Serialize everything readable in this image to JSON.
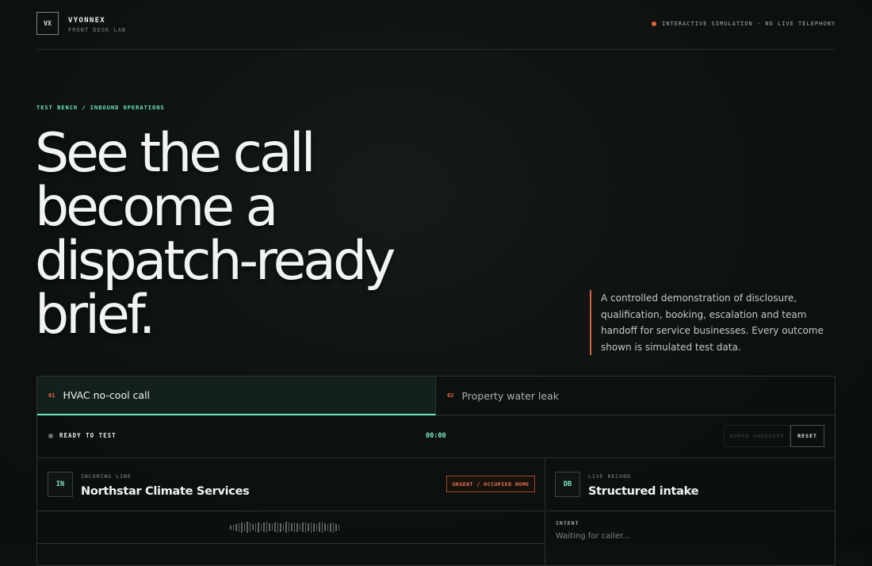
{
  "header": {
    "logo_mark": "VX",
    "brand_name": "VYONNEX",
    "brand_subtitle": "FRONT DESK LAB",
    "status": "INTERACTIVE SIMULATION · NO LIVE TELEPHONY",
    "status_color": "#e8632f"
  },
  "hero": {
    "eyebrow": "TEST BENCH / INBOUND OPERATIONS",
    "headline_lines": [
      "See the call",
      "become a",
      "dispatch-ready",
      "brief."
    ],
    "intro": "A controlled demonstration of disclosure, qualification, booking, escalation and team handoff for service businesses. Every outcome shown is simulated test data."
  },
  "tabs": [
    {
      "num": "01",
      "label": "HVAC no-cool call",
      "active": true
    },
    {
      "num": "02",
      "label": "Property water leak",
      "active": false
    }
  ],
  "controls": {
    "state": "READY TO TEST",
    "timer": "00:00",
    "handover_label": "HUMAN HANDOVER",
    "reset_label": "RESET"
  },
  "incoming": {
    "badge": "IN",
    "label": "INCOMING LINE",
    "title": "Northstar Climate Services",
    "tag": "URGENT / OCCUPIED HOME"
  },
  "record": {
    "badge": "DB",
    "label": "LIVE RECORD",
    "title": "Structured intake",
    "intent_label": "INTENT",
    "intent_value": "Waiting for caller..."
  },
  "accent_color": "#6ee7c3"
}
